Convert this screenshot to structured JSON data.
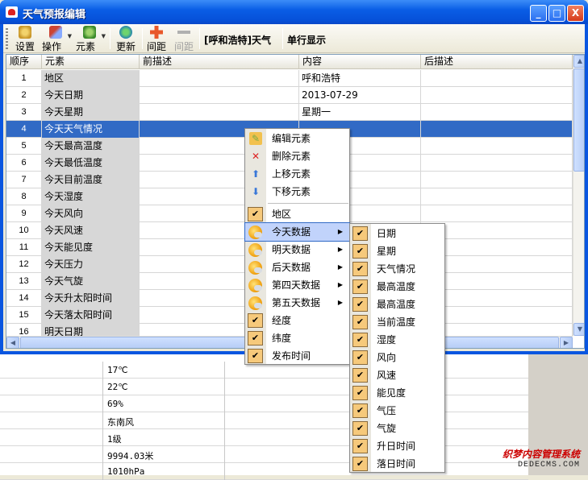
{
  "window": {
    "title": "天气预报编辑"
  },
  "titlebar_buttons": {
    "minimize": "_",
    "maximize": "□",
    "close": "X"
  },
  "toolbar": {
    "settings": "设置",
    "operate": "操作",
    "element": "元素",
    "refresh": "更新",
    "spacing": "间距",
    "spacing_disabled": "间距",
    "location_label": "[呼和浩特]天气",
    "single_line": "单行显示"
  },
  "grid": {
    "columns": [
      "顺序",
      "元素",
      "前描述",
      "内容",
      "后描述"
    ],
    "rows": [
      {
        "no": "1",
        "element": "地区",
        "content": "呼和浩特"
      },
      {
        "no": "2",
        "element": "今天日期",
        "content": "2013-07-29"
      },
      {
        "no": "3",
        "element": "今天星期",
        "content": "星期一"
      },
      {
        "no": "4",
        "element": "今天天气情况",
        "content": ""
      },
      {
        "no": "5",
        "element": "今天最高温度",
        "content": ""
      },
      {
        "no": "6",
        "element": "今天最低温度",
        "content": ""
      },
      {
        "no": "7",
        "element": "今天目前温度",
        "content": ""
      },
      {
        "no": "8",
        "element": "今天湿度",
        "content": ""
      },
      {
        "no": "9",
        "element": "今天风向",
        "content": ""
      },
      {
        "no": "10",
        "element": "今天风速",
        "content": ""
      },
      {
        "no": "11",
        "element": "今天能见度",
        "content": ""
      },
      {
        "no": "12",
        "element": "今天压力",
        "content": ""
      },
      {
        "no": "13",
        "element": "今天气旋",
        "content": ""
      },
      {
        "no": "14",
        "element": "今天升太阳时间",
        "content": ""
      },
      {
        "no": "15",
        "element": "今天落太阳时间",
        "content": ""
      },
      {
        "no": "16",
        "element": "明天日期",
        "content": ""
      }
    ],
    "selected_row": 4
  },
  "background_values": [
    "17℃",
    "22℃",
    "69%",
    "东南风",
    "1级",
    "9994.03米",
    "1010hPa"
  ],
  "context_menu": {
    "actions": [
      "编辑元素",
      "删除元素",
      "上移元素",
      "下移元素"
    ],
    "region": "地区",
    "groups": [
      "今天数据",
      "明天数据",
      "后天数据",
      "第四天数据",
      "第五天数据"
    ],
    "tail": [
      "经度",
      "纬度",
      "发布时间"
    ]
  },
  "submenu": {
    "items": [
      "日期",
      "星期",
      "天气情况",
      "最高温度",
      "最高温度",
      "当前温度",
      "湿度",
      "风向",
      "风速",
      "能见度",
      "气压",
      "气旋",
      "升日时间",
      "落日时间"
    ]
  },
  "watermark": {
    "line1": "织梦内容管理系统",
    "line2": "DEDECMS.COM"
  },
  "colors": {
    "selection": "#316ac5",
    "titlebar": "#0a5ee6",
    "check": "#f6c97b"
  }
}
